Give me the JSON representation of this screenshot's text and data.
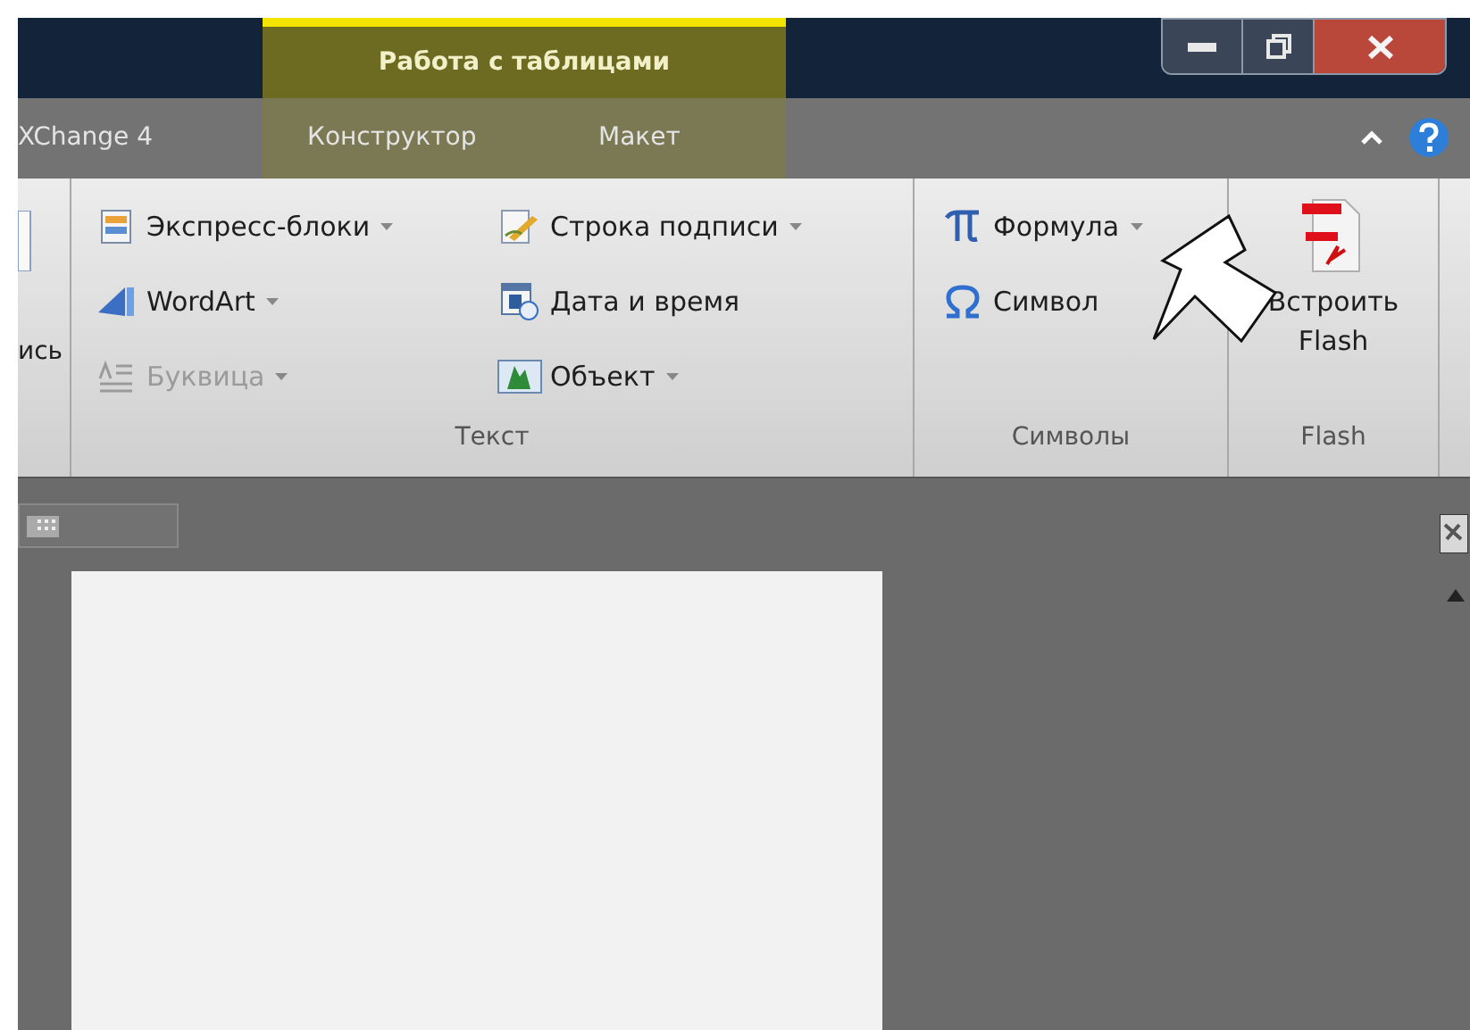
{
  "title_bar": {
    "contextual_tab": "Работа с таблицами"
  },
  "tabs": [
    {
      "label": "XChange 4",
      "selected": false,
      "contextual": false
    },
    {
      "label": "Конструктор",
      "selected": false,
      "contextual": true
    },
    {
      "label": "Макет",
      "selected": false,
      "contextual": true
    }
  ],
  "ribbon": {
    "partial_group": {
      "label": "ись"
    },
    "text_group": {
      "label": "Текст",
      "columns": [
        [
          {
            "label": "Экспресс-блоки",
            "dropdown": true,
            "disabled": false
          },
          {
            "label": "WordArt",
            "dropdown": true,
            "disabled": false
          },
          {
            "label": "Буквица",
            "dropdown": true,
            "disabled": true
          }
        ],
        [
          {
            "label": "Строка подписи",
            "dropdown": true,
            "disabled": false
          },
          {
            "label": "Дата и время",
            "dropdown": false,
            "disabled": false
          },
          {
            "label": "Объект",
            "dropdown": true,
            "disabled": false
          }
        ]
      ]
    },
    "symbols_group": {
      "label": "Символы",
      "items": [
        {
          "label": "Формула",
          "dropdown": true,
          "disabled": false
        },
        {
          "label": "Символ",
          "dropdown": false,
          "disabled": false
        }
      ]
    },
    "flash_group": {
      "label": "Flash",
      "button": "Встроить Flash"
    }
  }
}
